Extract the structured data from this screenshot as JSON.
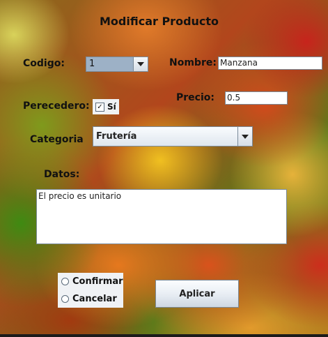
{
  "window": {
    "title": "Modificar Producto"
  },
  "form": {
    "codigo_label": "Codigo:",
    "codigo_value": "1",
    "nombre_label": "Nombre:",
    "nombre_value": "Manzana",
    "perecedero_label": "Perecedero:",
    "perecedero_checked": true,
    "perecedero_option": "Sí",
    "precio_label": "Precio:",
    "precio_value": "0.5",
    "categoria_label": "Categoria",
    "categoria_value": "Frutería",
    "datos_label": "Datos:",
    "datos_value": "El precio es unitario"
  },
  "actions": {
    "confirmar_label": "Confirmar",
    "cancelar_label": "Cancelar",
    "aplicar_label": "Aplicar"
  },
  "icons": {
    "dropdown": "chevron-down-icon",
    "check": "check-icon"
  }
}
